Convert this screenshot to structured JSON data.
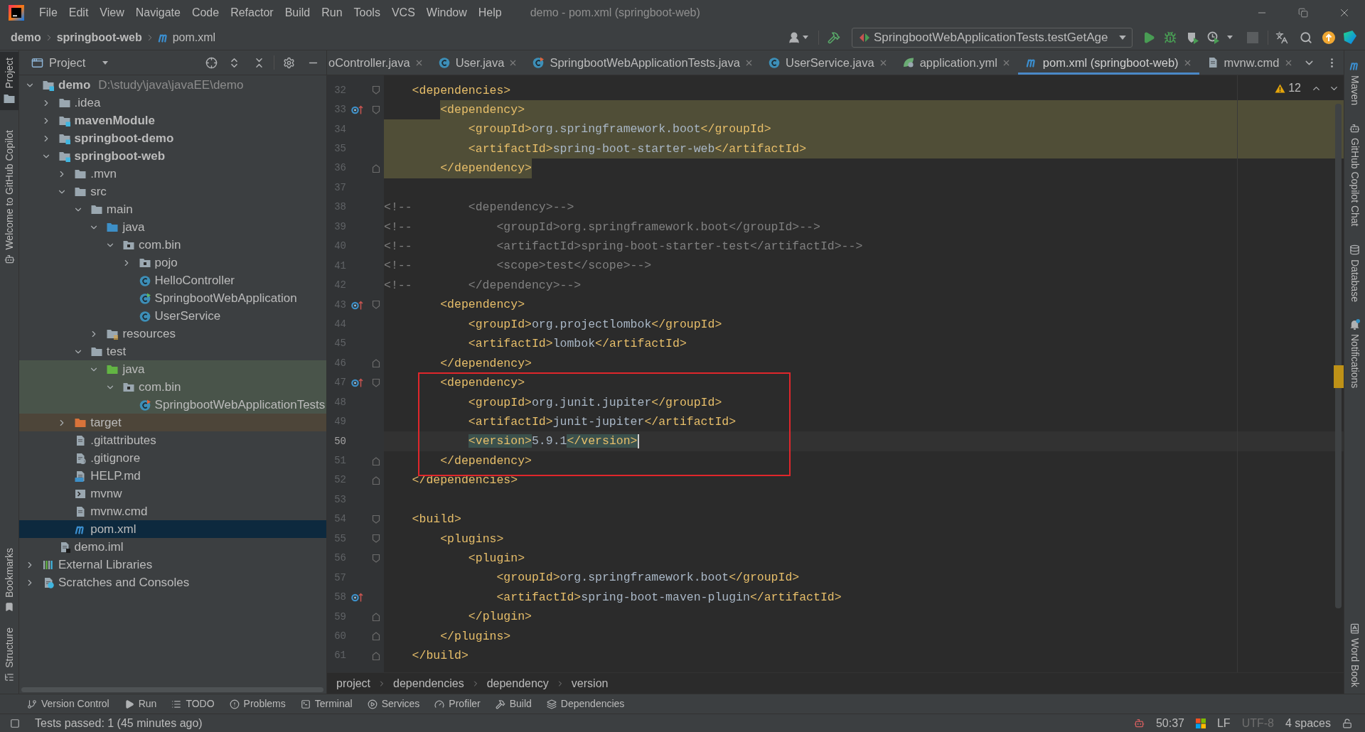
{
  "title_bar": {
    "menu": [
      "File",
      "Edit",
      "View",
      "Navigate",
      "Code",
      "Refactor",
      "Build",
      "Run",
      "Tools",
      "VCS",
      "Window",
      "Help"
    ],
    "title": "demo - pom.xml (springboot-web)"
  },
  "nav_bar": {
    "breadcrumbs": [
      {
        "label": "demo",
        "kind": "project"
      },
      {
        "label": "springboot-web",
        "kind": "module"
      },
      {
        "label": "pom.xml",
        "kind": "maven"
      }
    ],
    "run_configuration": "SpringbootWebApplicationTests.testGetAge"
  },
  "left_stripe": {
    "top": [
      {
        "label": "Project",
        "kind": "project",
        "selected": true
      },
      {
        "label": "Welcome to GitHub Copilot",
        "kind": "copilot",
        "selected": false
      }
    ],
    "bottom": [
      {
        "label": "Bookmarks",
        "kind": "bookmarks",
        "selected": false
      },
      {
        "label": "Structure",
        "kind": "structure",
        "selected": false
      }
    ]
  },
  "project_panel": {
    "title": "Project",
    "tree": [
      {
        "label": "demo",
        "kind": "project",
        "path": "D:\\study\\java\\javaEE\\demo",
        "expanded": true,
        "selected": false,
        "children": [
          {
            "label": ".idea",
            "kind": "folder",
            "expanded": false,
            "selected": false
          },
          {
            "label": "mavenModule",
            "kind": "module",
            "expanded": false,
            "selected": false
          },
          {
            "label": "springboot-demo",
            "kind": "module",
            "expanded": false,
            "selected": false
          },
          {
            "label": "springboot-web",
            "kind": "module",
            "expanded": true,
            "selected": false,
            "children": [
              {
                "label": ".mvn",
                "kind": "folder",
                "expanded": false,
                "selected": false
              },
              {
                "label": "src",
                "kind": "folder",
                "expanded": true,
                "selected": false,
                "children": [
                  {
                    "label": "main",
                    "kind": "folder",
                    "expanded": true,
                    "selected": false,
                    "children": [
                      {
                        "label": "java",
                        "kind": "source_root",
                        "expanded": true,
                        "selected": false,
                        "children": [
                          {
                            "label": "com.bin",
                            "kind": "package",
                            "expanded": true,
                            "selected": false,
                            "children": [
                              {
                                "label": "pojo",
                                "kind": "package",
                                "expanded": false,
                                "selected": false
                              },
                              {
                                "label": "HelloController",
                                "kind": "class",
                                "selected": false
                              },
                              {
                                "label": "SpringbootWebApplication",
                                "kind": "boot_class",
                                "selected": false
                              },
                              {
                                "label": "UserService",
                                "kind": "class",
                                "selected": false
                              }
                            ]
                          }
                        ]
                      },
                      {
                        "label": "resources",
                        "kind": "resources_root",
                        "expanded": false,
                        "selected": false
                      }
                    ]
                  },
                  {
                    "label": "test",
                    "kind": "folder",
                    "expanded": true,
                    "selected": false,
                    "children": [
                      {
                        "label": "java",
                        "kind": "test_root",
                        "color": "#49544a",
                        "expanded": true,
                        "selected": false,
                        "children": [
                          {
                            "label": "com.bin",
                            "kind": "package",
                            "color": "#49544a",
                            "expanded": true,
                            "selected": false,
                            "children": [
                              {
                                "label": "SpringbootWebApplicationTests",
                                "kind": "test_class",
                                "color": "#49544a",
                                "selected": false
                              }
                            ]
                          }
                        ]
                      }
                    ]
                  }
                ]
              },
              {
                "label": "target",
                "kind": "excluded",
                "color": "#4d4539",
                "expanded": false,
                "selected": false
              },
              {
                "label": ".gitattributes",
                "kind": "file",
                "selected": false
              },
              {
                "label": ".gitignore",
                "kind": "ignore_file",
                "selected": false
              },
              {
                "label": "HELP.md",
                "kind": "markdown",
                "selected": false
              },
              {
                "label": "mvnw",
                "kind": "script",
                "selected": false
              },
              {
                "label": "mvnw.cmd",
                "kind": "file",
                "selected": false
              },
              {
                "label": "pom.xml",
                "kind": "maven",
                "selected": true
              }
            ]
          },
          {
            "label": "demo.iml",
            "kind": "iml",
            "selected": false
          }
        ]
      },
      {
        "label": "External Libraries",
        "kind": "libraries",
        "expanded": false,
        "selected": false
      },
      {
        "label": "Scratches and Consoles",
        "kind": "scratches",
        "expanded": false,
        "selected": false
      }
    ]
  },
  "editor": {
    "tabs": [
      {
        "label": "oController.java",
        "kind": "none",
        "selected": false
      },
      {
        "label": "User.java",
        "kind": "class",
        "selected": false
      },
      {
        "label": "SpringbootWebApplicationTests.java",
        "kind": "test_class",
        "selected": false
      },
      {
        "label": "UserService.java",
        "kind": "class",
        "selected": false
      },
      {
        "label": "application.yml",
        "kind": "spring_config",
        "selected": false
      },
      {
        "label": "pom.xml (springboot-web)",
        "kind": "maven",
        "selected": true
      },
      {
        "label": "mvnw.cmd",
        "kind": "file",
        "selected": false
      }
    ],
    "warning_count": "12",
    "lines": [
      {
        "number": "32",
        "text": "    <dependencies>",
        "kind": "code",
        "fold_start": true,
        "fold_end": false,
        "gutter_mark": false,
        "highlighted": false,
        "current": false,
        "annotated": false
      },
      {
        "number": "33",
        "text": "        <dependency>",
        "kind": "code",
        "fold_start": true,
        "fold_end": false,
        "gutter_mark": true,
        "highlighted": true,
        "current": false,
        "annotated": false
      },
      {
        "number": "34",
        "text": "            <groupId>org.springframework.boot</groupId>",
        "kind": "code",
        "fold_start": false,
        "fold_end": false,
        "gutter_mark": false,
        "highlighted": true,
        "current": false,
        "annotated": false
      },
      {
        "number": "35",
        "text": "            <artifactId>spring-boot-starter-web</artifactId>",
        "kind": "code",
        "fold_start": false,
        "fold_end": false,
        "gutter_mark": false,
        "highlighted": true,
        "current": false,
        "annotated": false
      },
      {
        "number": "36",
        "text": "        </dependency>",
        "kind": "code",
        "fold_start": false,
        "fold_end": true,
        "gutter_mark": false,
        "highlighted": true,
        "current": false,
        "annotated": false
      },
      {
        "number": "37",
        "kind": "code",
        "fold_start": false,
        "fold_end": false,
        "gutter_mark": false,
        "highlighted": false,
        "current": false,
        "annotated": false
      },
      {
        "number": "38",
        "text": "<!--        <dependency>-->",
        "kind": "comment",
        "fold_start": false,
        "fold_end": false,
        "gutter_mark": false,
        "highlighted": false,
        "current": false,
        "annotated": false
      },
      {
        "number": "39",
        "text": "<!--            <groupId>org.springframework.boot</groupId>-->",
        "kind": "comment",
        "fold_start": false,
        "fold_end": false,
        "gutter_mark": false,
        "highlighted": false,
        "current": false,
        "annotated": false
      },
      {
        "number": "40",
        "text": "<!--            <artifactId>spring-boot-starter-test</artifactId>-->",
        "kind": "comment",
        "fold_start": false,
        "fold_end": false,
        "gutter_mark": false,
        "highlighted": false,
        "current": false,
        "annotated": false
      },
      {
        "number": "41",
        "text": "<!--            <scope>test</scope>-->",
        "kind": "comment",
        "fold_start": false,
        "fold_end": false,
        "gutter_mark": false,
        "highlighted": false,
        "current": false,
        "annotated": false
      },
      {
        "number": "42",
        "text": "<!--        </dependency>-->",
        "kind": "comment",
        "fold_start": false,
        "fold_end": false,
        "gutter_mark": false,
        "highlighted": false,
        "current": false,
        "annotated": false
      },
      {
        "number": "43",
        "text": "        <dependency>",
        "kind": "code",
        "fold_start": true,
        "fold_end": false,
        "gutter_mark": true,
        "highlighted": false,
        "current": false,
        "annotated": false
      },
      {
        "number": "44",
        "text": "            <groupId>org.projectlombok</groupId>",
        "kind": "code",
        "fold_start": false,
        "fold_end": false,
        "gutter_mark": false,
        "highlighted": false,
        "current": false,
        "annotated": false
      },
      {
        "number": "45",
        "text": "            <artifactId>lombok</artifactId>",
        "kind": "code",
        "fold_start": false,
        "fold_end": false,
        "gutter_mark": false,
        "highlighted": false,
        "current": false,
        "annotated": false
      },
      {
        "number": "46",
        "text": "        </dependency>",
        "kind": "code",
        "fold_start": false,
        "fold_end": true,
        "gutter_mark": false,
        "highlighted": false,
        "current": false,
        "annotated": false
      },
      {
        "number": "47",
        "text": "        <dependency>",
        "kind": "code",
        "fold_start": true,
        "fold_end": false,
        "gutter_mark": true,
        "highlighted": false,
        "current": false,
        "annotated": true
      },
      {
        "number": "48",
        "text": "            <groupId>org.junit.jupiter</groupId>",
        "kind": "code",
        "fold_start": false,
        "fold_end": false,
        "gutter_mark": false,
        "highlighted": false,
        "current": false,
        "annotated": true
      },
      {
        "number": "49",
        "text": "            <artifactId>junit-jupiter</artifactId>",
        "kind": "code",
        "fold_start": false,
        "fold_end": false,
        "gutter_mark": false,
        "highlighted": false,
        "current": false,
        "annotated": true
      },
      {
        "number": "50",
        "text": "            <version>5.9.1</version>",
        "kind": "code",
        "fold_start": false,
        "fold_end": false,
        "gutter_mark": false,
        "highlighted": false,
        "current": true,
        "annotated": true
      },
      {
        "number": "51",
        "text": "        </dependency>",
        "kind": "code",
        "fold_start": false,
        "fold_end": true,
        "gutter_mark": false,
        "highlighted": false,
        "current": false,
        "annotated": true
      },
      {
        "number": "52",
        "text": "    </dependencies>",
        "kind": "code",
        "fold_start": false,
        "fold_end": true,
        "gutter_mark": false,
        "highlighted": false,
        "current": false,
        "annotated": false
      },
      {
        "number": "53",
        "kind": "code",
        "fold_start": false,
        "fold_end": false,
        "gutter_mark": false,
        "highlighted": false,
        "current": false,
        "annotated": false
      },
      {
        "number": "54",
        "text": "    <build>",
        "kind": "code",
        "fold_start": true,
        "fold_end": false,
        "gutter_mark": false,
        "highlighted": false,
        "current": false,
        "annotated": false
      },
      {
        "number": "55",
        "text": "        <plugins>",
        "kind": "code",
        "fold_start": true,
        "fold_end": false,
        "gutter_mark": false,
        "highlighted": false,
        "current": false,
        "annotated": false
      },
      {
        "number": "56",
        "text": "            <plugin>",
        "kind": "code",
        "fold_start": true,
        "fold_end": false,
        "gutter_mark": false,
        "highlighted": false,
        "current": false,
        "annotated": false
      },
      {
        "number": "57",
        "text": "                <groupId>org.springframework.boot</groupId>",
        "kind": "code",
        "fold_start": false,
        "fold_end": false,
        "gutter_mark": false,
        "highlighted": false,
        "current": false,
        "annotated": false
      },
      {
        "number": "58",
        "text": "                <artifactId>spring-boot-maven-plugin</artifactId>",
        "kind": "code",
        "fold_start": false,
        "fold_end": false,
        "gutter_mark": true,
        "highlighted": false,
        "current": false,
        "annotated": false
      },
      {
        "number": "59",
        "text": "            </plugin>",
        "kind": "code",
        "fold_start": false,
        "fold_end": true,
        "gutter_mark": false,
        "highlighted": false,
        "current": false,
        "annotated": false
      },
      {
        "number": "60",
        "text": "        </plugins>",
        "kind": "code",
        "fold_start": false,
        "fold_end": true,
        "gutter_mark": false,
        "highlighted": false,
        "current": false,
        "annotated": false
      },
      {
        "number": "61",
        "text": "    </build>",
        "kind": "code",
        "fold_start": false,
        "fold_end": true,
        "gutter_mark": false,
        "highlighted": false,
        "current": false,
        "annotated": false
      }
    ],
    "breadcrumbs": [
      "project",
      "dependencies",
      "dependency",
      "version"
    ]
  },
  "right_stripe": {
    "top": [
      {
        "label": "Maven",
        "kind": "maven"
      },
      {
        "label": "GitHub Copilot Chat",
        "kind": "copilot"
      },
      {
        "label": "Database",
        "kind": "database"
      },
      {
        "label": "Notifications",
        "kind": "notifications"
      }
    ],
    "bottom": [
      {
        "label": "Word Book",
        "kind": "book"
      }
    ]
  },
  "tool_windows": [
    {
      "label": "Version Control",
      "kind": "vcs"
    },
    {
      "label": "Run",
      "kind": "run"
    },
    {
      "label": "TODO",
      "kind": "todo"
    },
    {
      "label": "Problems",
      "kind": "problems"
    },
    {
      "label": "Terminal",
      "kind": "terminal"
    },
    {
      "label": "Services",
      "kind": "services"
    },
    {
      "label": "Profiler",
      "kind": "profiler"
    },
    {
      "label": "Build",
      "kind": "build"
    },
    {
      "label": "Dependencies",
      "kind": "dependencies"
    }
  ],
  "status_bar": {
    "message": "Tests passed: 1 (45 minutes ago)",
    "caret_position": "50:37",
    "line_separator": "LF",
    "encoding": {
      "label": "UTF-8",
      "disabled": true
    },
    "indent": "4 spaces"
  }
}
